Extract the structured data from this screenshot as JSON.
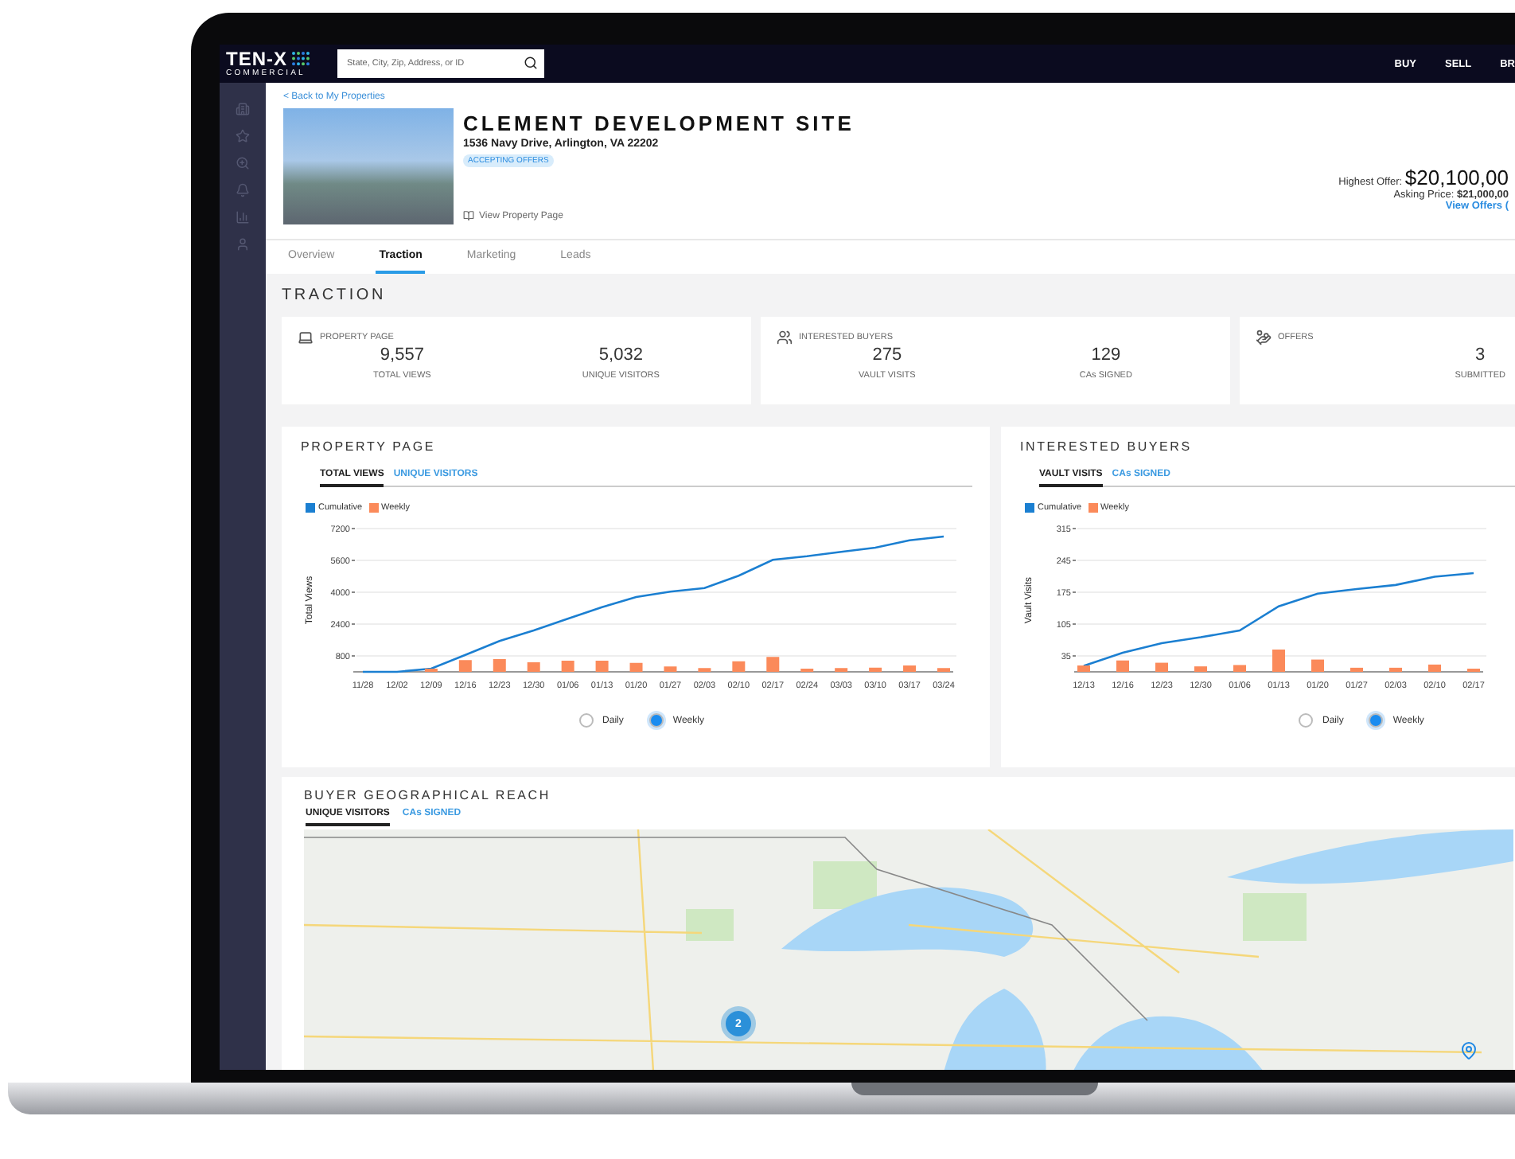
{
  "header": {
    "logo": {
      "name": "TEN-X",
      "sub": "COMMERCIAL"
    },
    "search": {
      "placeholder": "State, City, Zip, Address, or ID"
    },
    "nav": [
      "BUY",
      "SELL",
      "BR"
    ]
  },
  "property": {
    "back_link": "< Back to My Properties",
    "title": "CLEMENT DEVELOPMENT SITE",
    "address": "1536 Navy Drive, Arlington, VA 22202",
    "status": "ACCEPTING OFFERS",
    "view_link": "View Property Page",
    "highest_offer_label": "Highest Offer:",
    "highest_offer": "$20,100,00",
    "asking_label": "Asking Price:",
    "asking": "$21,000,00",
    "view_offers": "View Offers ("
  },
  "tabs": [
    {
      "label": "Overview",
      "selected": false
    },
    {
      "label": "Traction",
      "selected": true
    },
    {
      "label": "Marketing",
      "selected": false
    },
    {
      "label": "Leads",
      "selected": false
    }
  ],
  "section_title": "TRACTION",
  "stats": [
    {
      "kind": "laptop",
      "title": "PROPERTY PAGE",
      "metrics": [
        {
          "value": "9,557",
          "label": "TOTAL VIEWS"
        },
        {
          "value": "5,032",
          "label": "UNIQUE VISITORS"
        }
      ]
    },
    {
      "kind": "people",
      "title": "INTERESTED BUYERS",
      "metrics": [
        {
          "value": "275",
          "label": "VAULT VISITS"
        },
        {
          "value": "129",
          "label": "CAs SIGNED"
        }
      ]
    },
    {
      "kind": "offer",
      "title": "OFFERS",
      "metrics": [
        {
          "value": "3",
          "label": "SUBMITTED"
        }
      ]
    }
  ],
  "charts": [
    {
      "title": "PROPERTY PAGE",
      "tabs": [
        {
          "label": "TOTAL VIEWS",
          "selected": true
        },
        {
          "label": "UNIQUE VISITORS",
          "selected": false
        }
      ],
      "periods": [
        {
          "label": "Daily",
          "selected": false
        },
        {
          "label": "Weekly",
          "selected": true
        }
      ],
      "chart_data": {
        "type": "line",
        "grid": true,
        "ylabel": "Total Views",
        "categories": [
          "11/28",
          "12/02",
          "12/09",
          "12/16",
          "12/23",
          "12/30",
          "01/06",
          "01/13",
          "01/20",
          "01/27",
          "02/03",
          "02/10",
          "02/17",
          "02/24",
          "03/03",
          "03/10",
          "03/17",
          "03/24"
        ],
        "ylim": [
          0,
          7200
        ],
        "yticks": [
          800,
          2400,
          4000,
          5600,
          7200
        ],
        "series": [
          {
            "name": "Cumulative",
            "type": "line",
            "color": "#1b7fd1",
            "values": [
              0,
              0,
              160,
              850,
              1550,
              2080,
              2670,
              3250,
              3760,
              4030,
              4210,
              4830,
              5630,
              5810,
              6030,
              6240,
              6610,
              6800
            ]
          },
          {
            "name": "Weekly",
            "type": "bar",
            "color": "#fb8a5a",
            "values": [
              0,
              0,
              160,
              590,
              640,
              480,
              560,
              560,
              450,
              270,
              190,
              530,
              750,
              160,
              190,
              210,
              320,
              190
            ]
          }
        ]
      }
    },
    {
      "title": "INTERESTED BUYERS",
      "tabs": [
        {
          "label": "VAULT VISITS",
          "selected": true
        },
        {
          "label": "CAs SIGNED",
          "selected": false
        }
      ],
      "periods": [
        {
          "label": "Daily",
          "selected": false
        },
        {
          "label": "Weekly",
          "selected": true
        }
      ],
      "chart_data": {
        "type": "line",
        "grid": true,
        "ylabel": "Vault Visits",
        "categories": [
          "12/13",
          "12/16",
          "12/23",
          "12/30",
          "01/06",
          "01/13",
          "01/20",
          "01/27",
          "02/03",
          "02/10",
          "02/17"
        ],
        "ylim": [
          0,
          315
        ],
        "yticks": [
          35,
          105,
          175,
          245,
          315
        ],
        "series": [
          {
            "name": "Cumulative",
            "type": "line",
            "color": "#1b7fd1",
            "values": [
              13,
              42,
              63,
              76,
              91,
              144,
              172,
              182,
              191,
              209,
              217
            ]
          },
          {
            "name": "Weekly",
            "type": "bar",
            "color": "#fb8a5a",
            "values": [
              14,
              25,
              20,
              12,
              15,
              49,
              27,
              9,
              9,
              16,
              7
            ]
          }
        ]
      }
    }
  ],
  "reach": {
    "title": "BUYER GEOGRAPHICAL REACH",
    "tabs": [
      {
        "label": "UNIQUE VISITORS",
        "selected": true
      },
      {
        "label": "CAs SIGNED",
        "selected": false
      }
    ],
    "markers": [
      {
        "count": "2"
      }
    ]
  }
}
